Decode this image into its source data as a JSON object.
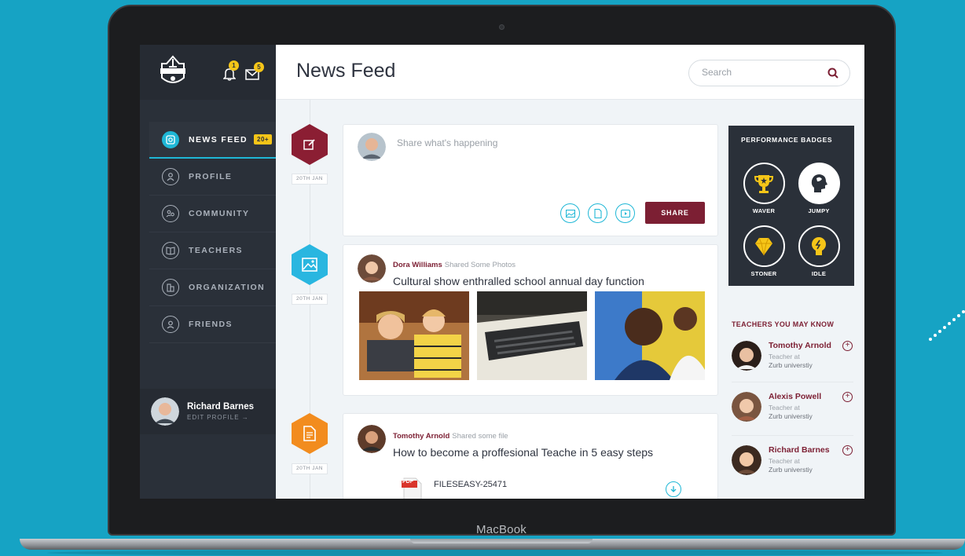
{
  "device": {
    "chin_label": "MacBook"
  },
  "sidebar": {
    "logo_icon": "school-crest-icon",
    "notifications_count": "1",
    "messages_count": "5",
    "items": [
      {
        "label": "NEWS FEED",
        "icon": "news-feed-icon",
        "badge": "20+",
        "active": true
      },
      {
        "label": "PROFILE",
        "icon": "profile-icon"
      },
      {
        "label": "COMMUNITY",
        "icon": "community-icon"
      },
      {
        "label": "TEACHERS",
        "icon": "book-icon"
      },
      {
        "label": "ORGANIZATION",
        "icon": "building-icon"
      },
      {
        "label": "FRIENDS",
        "icon": "friends-icon"
      }
    ],
    "user": {
      "name": "Richard Barnes",
      "edit_label": "EDIT PROFILE →"
    }
  },
  "header": {
    "title": "News Feed",
    "search_placeholder": "Search"
  },
  "feed": {
    "composer": {
      "placeholder": "Share what's happening",
      "share_label": "SHARE",
      "date": "20TH JAN",
      "accent": "#8b1e33"
    },
    "posts": [
      {
        "date": "20TH JAN",
        "accent": "#29b6e0",
        "author": "Dora Williams",
        "action": "Shared Some Photos",
        "title": "Cultural show enthralled school annual day function"
      },
      {
        "date": "20TH JAN",
        "accent": "#f28c1e",
        "author": "Tomothy Arnold",
        "action": "Shared some file",
        "title": "How to become a proffesional Teache in 5 easy steps",
        "file": {
          "name": "FILESEASY-25471",
          "type": "PDF"
        }
      }
    ]
  },
  "right_panel": {
    "badges_title": "PERFORMANCE BADGES",
    "badges": [
      {
        "label": "WAVER",
        "icon": "trophy-icon"
      },
      {
        "label": "JUMPY",
        "icon": "head-icon"
      },
      {
        "label": "STONER",
        "icon": "diamond-icon"
      },
      {
        "label": "IDLE",
        "icon": "bulb-icon"
      }
    ],
    "teachers_title": "TEACHERS YOU MAY KNOW",
    "teachers": [
      {
        "name": "Tomothy Arnold",
        "role_line1": "Teacher at",
        "role_line2": "Zurb universtiy"
      },
      {
        "name": "Alexis Powell",
        "role_line1": "Teacher at",
        "role_line2": "Zurb universtiy"
      },
      {
        "name": "Richard Barnes",
        "role_line1": "Teacher at",
        "role_line2": "Zurb universtiy"
      }
    ]
  }
}
